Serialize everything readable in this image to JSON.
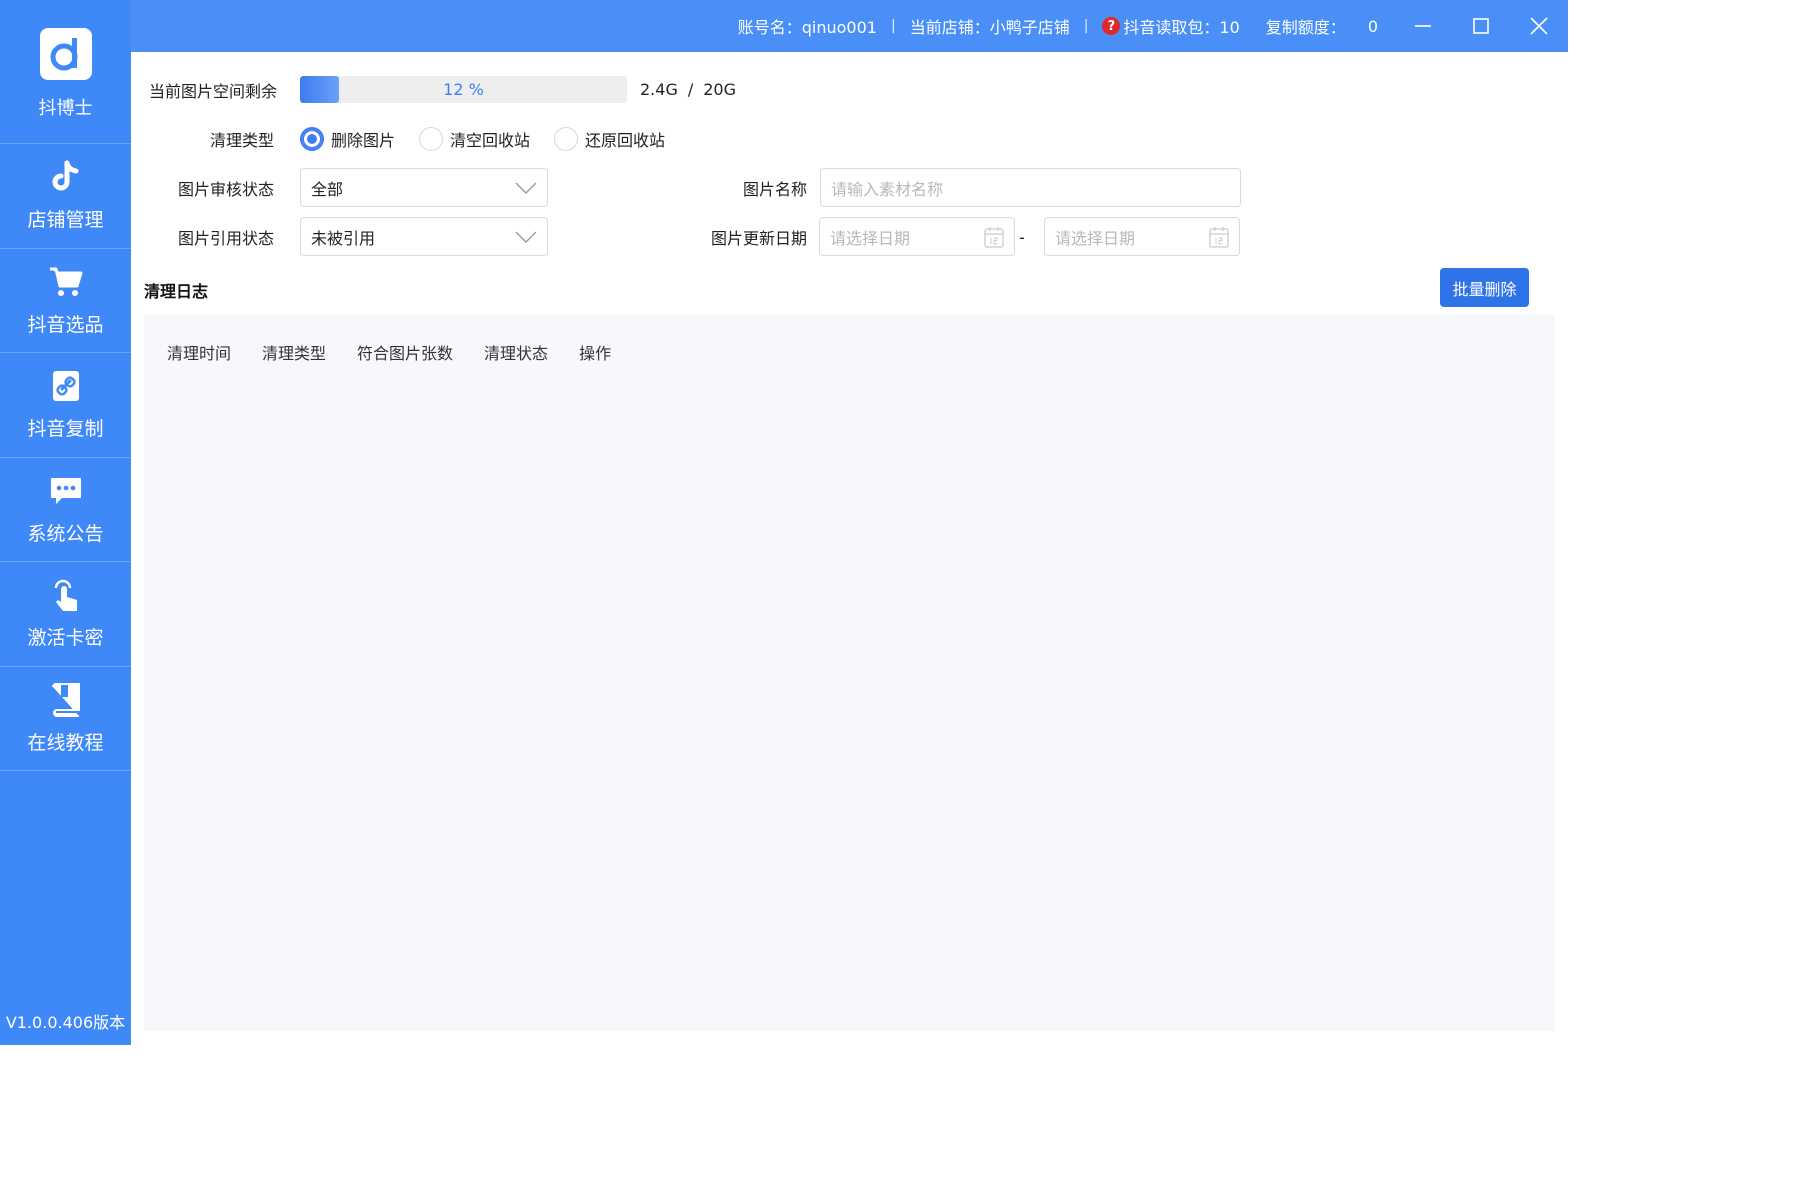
{
  "brand": {
    "name": "抖博士"
  },
  "sidebar": {
    "items": [
      {
        "label": "店铺管理",
        "icon": "tiktok-icon"
      },
      {
        "label": "抖音选品",
        "icon": "cart-icon"
      },
      {
        "label": "抖音复制",
        "icon": "link-icon"
      },
      {
        "label": "系统公告",
        "icon": "chat-icon"
      },
      {
        "label": "激活卡密",
        "icon": "tap-icon"
      },
      {
        "label": "在线教程",
        "icon": "book-icon"
      }
    ],
    "version": "V1.0.0.406版本"
  },
  "topbar": {
    "account": "账号名：qinuo001",
    "store": "当前店铺：小鸭子店铺",
    "read_packets": "抖音读取包：10",
    "copy_quota_label": "复制额度：",
    "copy_quota_value": "0",
    "separator": "|",
    "help_symbol": "?"
  },
  "storage": {
    "label": "当前图片空间剩余",
    "percent_text": "12 %",
    "percent": 12,
    "used": "2.4G",
    "slash": "/",
    "total": "20G"
  },
  "clean_type": {
    "label": "清理类型",
    "options": [
      "删除图片",
      "清空回收站",
      "还原回收站"
    ],
    "selected_index": 0
  },
  "review_status": {
    "label": "图片审核状态",
    "value": "全部"
  },
  "ref_status": {
    "label": "图片引用状态",
    "value": "未被引用"
  },
  "image_name": {
    "label": "图片名称",
    "placeholder": "请输入素材名称"
  },
  "update_date": {
    "label": "图片更新日期",
    "start_placeholder": "请选择日期",
    "end_placeholder": "请选择日期",
    "range_sep": "-"
  },
  "log": {
    "title": "清理日志",
    "batch_delete": "批量删除",
    "columns": [
      "清理时间",
      "清理类型",
      "符合图片张数",
      "清理状态",
      "操作"
    ]
  },
  "colors": {
    "sidebar": "#3f88f8",
    "topbar": "#4a8ff8",
    "primary": "#2e73e8",
    "accent": "#3f7ef2"
  }
}
